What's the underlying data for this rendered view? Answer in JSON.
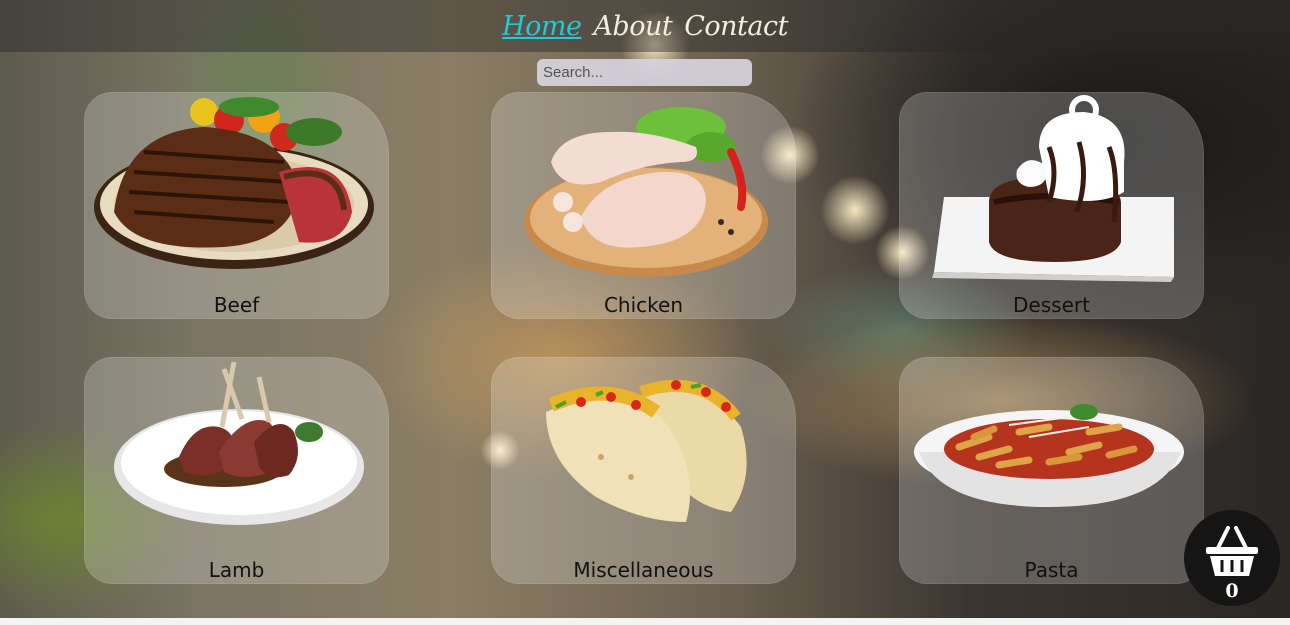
{
  "nav": {
    "links": [
      "Home",
      "About",
      "Contact"
    ],
    "active": "Home"
  },
  "search": {
    "placeholder": "Search...",
    "value": ""
  },
  "categories": [
    {
      "label": "Beef",
      "image": "steak-plate"
    },
    {
      "label": "Chicken",
      "image": "raw-chicken-board"
    },
    {
      "label": "Dessert",
      "image": "lava-cake-plate"
    },
    {
      "label": "Lamb",
      "image": "lamb-chops-plate"
    },
    {
      "label": "Miscellaneous",
      "image": "tacos"
    },
    {
      "label": "Pasta",
      "image": "penne-bowl"
    }
  ],
  "cart": {
    "icon": "basket-icon",
    "count": "0"
  },
  "colors": {
    "active_link": "#22c9d8",
    "link": "#f3eede",
    "card_bg": "rgba(255,255,255,0.22)"
  }
}
